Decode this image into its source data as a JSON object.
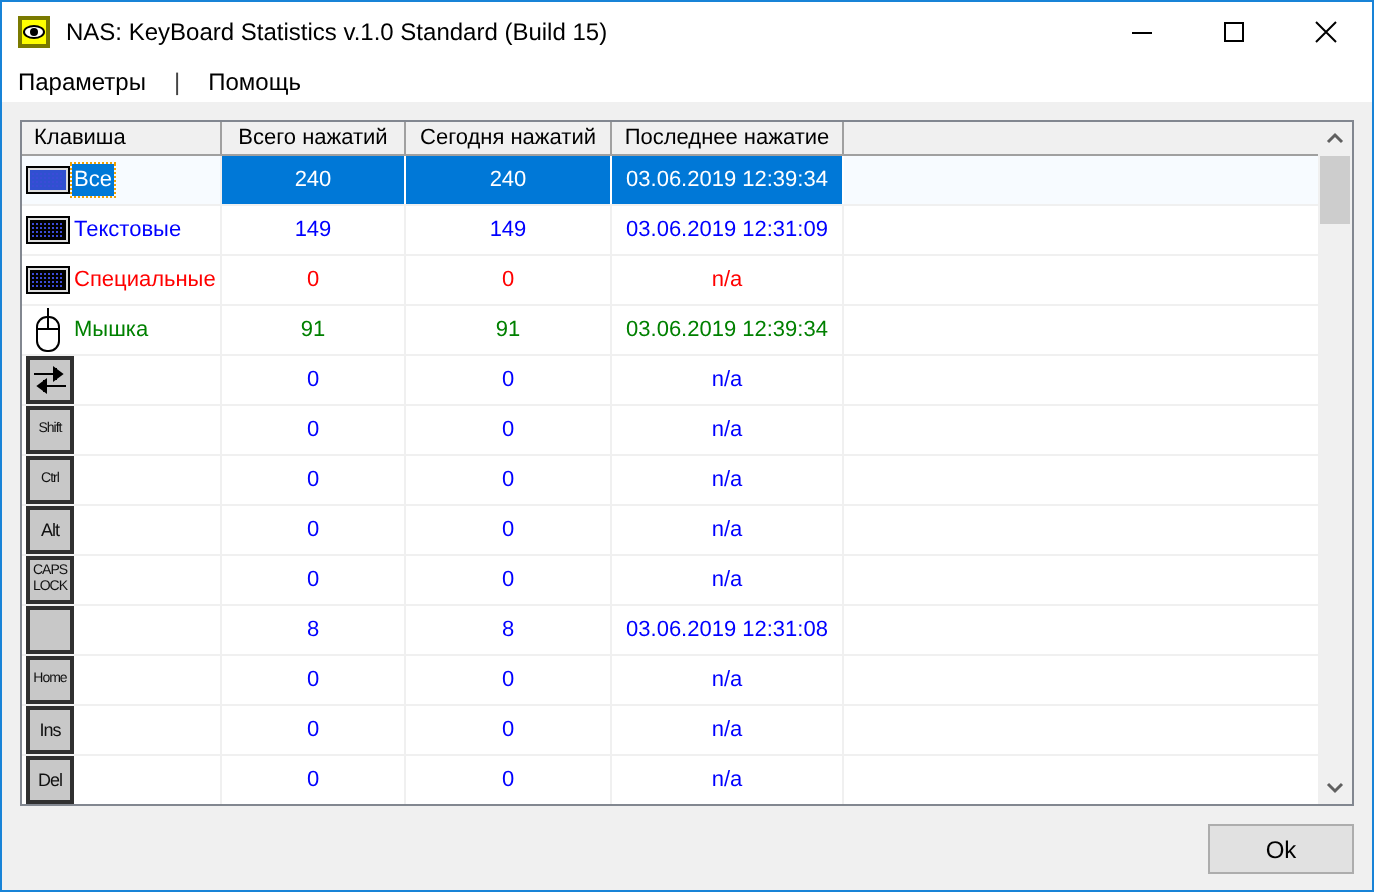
{
  "window": {
    "title": "NAS: KeyBoard Statistics v.1.0 Standard (Build 15)"
  },
  "menu": [
    {
      "label": "Параметры"
    },
    {
      "label": "|",
      "kind": "separator"
    },
    {
      "label": "Помощь"
    }
  ],
  "table": {
    "columns": [
      "Клавиша",
      "Всего нажатий",
      "Сегодня нажатий",
      "Последнее нажатие"
    ],
    "rows": [
      {
        "kind": "keyboard",
        "name": "Все",
        "total": "240",
        "today": "240",
        "last": "03.06.2019 12:39:34",
        "selected": true
      },
      {
        "kind": "keyboard",
        "name": "Текстовые",
        "total": "149",
        "today": "149",
        "last": "03.06.2019 12:31:09",
        "color": "#0000ff",
        "selected": false
      },
      {
        "kind": "keyboard",
        "name": "Специальные",
        "total": "0",
        "today": "0",
        "last": "n/a",
        "color": "#ff0000",
        "selected": false
      },
      {
        "kind": "mouse",
        "name": "Мышка",
        "total": "91",
        "today": "91",
        "last": "03.06.2019 12:39:34",
        "color": "#008000",
        "selected": false
      },
      {
        "kind": "tab_key",
        "total": "0",
        "today": "0",
        "last": "n/a",
        "color": "#0000ff",
        "selected": false
      },
      {
        "kind": "key",
        "key_label": "Shift",
        "total": "0",
        "today": "0",
        "last": "n/a",
        "color": "#0000ff",
        "selected": false
      },
      {
        "kind": "key",
        "key_label": "Ctrl",
        "total": "0",
        "today": "0",
        "last": "n/a",
        "color": "#0000ff",
        "selected": false
      },
      {
        "kind": "key",
        "key_label": "Alt",
        "total": "0",
        "today": "0",
        "last": "n/a",
        "color": "#0000ff",
        "selected": false
      },
      {
        "kind": "key",
        "key_label": "CAPS LOCK",
        "total": "0",
        "today": "0",
        "last": "n/a",
        "color": "#0000ff",
        "selected": false
      },
      {
        "kind": "key",
        "total": "8",
        "today": "8",
        "last": "03.06.2019 12:31:08",
        "color": "#0000ff",
        "selected": false
      },
      {
        "kind": "key",
        "key_label": "Home",
        "total": "0",
        "today": "0",
        "last": "n/a",
        "color": "#0000ff",
        "selected": false
      },
      {
        "kind": "key",
        "key_label": "Ins",
        "total": "0",
        "today": "0",
        "last": "n/a",
        "color": "#0000ff",
        "selected": false
      },
      {
        "kind": "key",
        "key_label": "Del",
        "total": "0",
        "today": "0",
        "last": "n/a",
        "color": "#0000ff",
        "selected": false
      }
    ]
  },
  "buttons": [
    {
      "label": "Ok"
    }
  ]
}
